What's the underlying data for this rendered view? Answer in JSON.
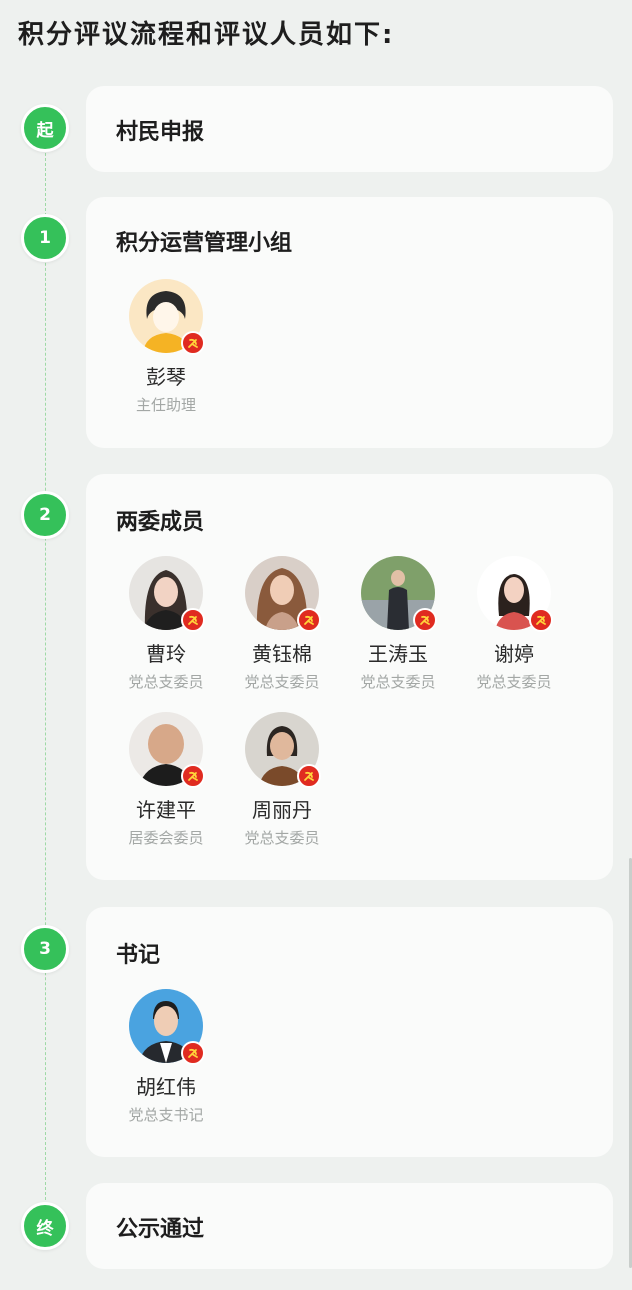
{
  "heading": "积分评议流程和评议人员如下:",
  "steps": [
    {
      "marker": "起",
      "title": "村民申报"
    },
    {
      "marker": "1",
      "title": "积分运营管理小组",
      "members": [
        {
          "name": "彭琴",
          "role": "主任助理"
        }
      ]
    },
    {
      "marker": "2",
      "title": "两委成员",
      "members": [
        {
          "name": "曹玲",
          "role": "党总支委员"
        },
        {
          "name": "黄钰棉",
          "role": "党总支委员"
        },
        {
          "name": "王涛玉",
          "role": "党总支委员"
        },
        {
          "name": "谢婷",
          "role": "党总支委员"
        },
        {
          "name": "许建平",
          "role": "居委会委员"
        },
        {
          "name": "周丽丹",
          "role": "党总支委员"
        }
      ]
    },
    {
      "marker": "3",
      "title": "书记",
      "members": [
        {
          "name": "胡红伟",
          "role": "党总支书记"
        }
      ]
    },
    {
      "marker": "终",
      "title": "公示通过"
    }
  ],
  "colors": {
    "accent": "#35c15a",
    "party_badge": "#e02b20"
  },
  "icons": {
    "member_badge": "party-emblem-icon"
  }
}
